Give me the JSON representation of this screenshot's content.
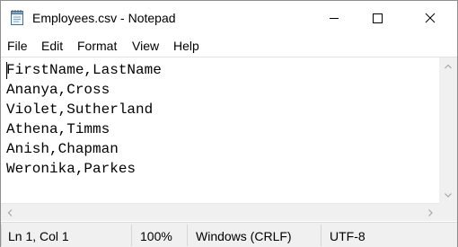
{
  "window": {
    "title": "Employees.csv - Notepad",
    "icon": "notepad-icon"
  },
  "menu": {
    "items": [
      {
        "label": "File"
      },
      {
        "label": "Edit"
      },
      {
        "label": "Format"
      },
      {
        "label": "View"
      },
      {
        "label": "Help"
      }
    ]
  },
  "document": {
    "lines": [
      "FirstName,LastName",
      "Ananya,Cross",
      "Violet,Sutherland",
      "Athena,Timms",
      "Anish,Chapman",
      "Weronika,Parkes"
    ]
  },
  "status": {
    "position": "Ln 1, Col 1",
    "zoom": "100%",
    "line_ending": "Windows (CRLF)",
    "encoding": "UTF-8"
  },
  "colors": {
    "window_border": "#8f8f8f",
    "scrollbar": "#f0f0f0",
    "statusbar": "#f0f0f0"
  }
}
